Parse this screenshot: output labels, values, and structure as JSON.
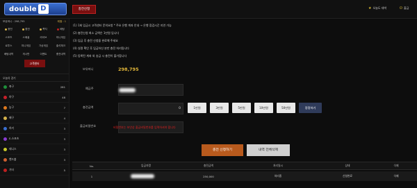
{
  "header": {
    "logo_text": "double",
    "logo_letter": "D",
    "active_tab": "충전신청",
    "right_items": [
      {
        "icon": "star-icon",
        "label": "오늘도 대박"
      },
      {
        "icon": "power-icon",
        "label": "출금"
      }
    ]
  },
  "sidebar": {
    "user_left": "보유머니 : 298,795",
    "user_right": "레벨 : 1",
    "grid": [
      [
        "충전",
        "환전",
        "쪽지",
        "베팅"
      ],
      [
        "스포츠",
        "스페셜",
        "라이브",
        "미니게임"
      ],
      [
        "로투스",
        "미니게임",
        "가상게임",
        "출석체크"
      ],
      [
        "베팅내역",
        "게시판",
        "이벤트",
        "충전내역"
      ]
    ],
    "active_item": "고객센터",
    "section_title": "오늘의 경기",
    "sports": [
      {
        "name": "축구",
        "count": "281",
        "color": "#1e8f3a"
      },
      {
        "name": "야구",
        "count": "48",
        "color": "#c8202a"
      },
      {
        "name": "농구",
        "count": "7",
        "color": "#e07a1f"
      },
      {
        "name": "배구",
        "count": "4",
        "color": "#d6b34b"
      },
      {
        "name": "하키",
        "count": "3",
        "color": "#3a6fd1"
      },
      {
        "name": "E-스포츠",
        "count": "3",
        "color": "#8a3ad1"
      },
      {
        "name": "테니스",
        "count": "3",
        "color": "#c8c82a"
      },
      {
        "name": "핸드볼",
        "count": "3",
        "color": "#d06030"
      },
      {
        "name": "기타",
        "count": "5",
        "color": "#c02020"
      }
    ]
  },
  "notices": [
    "(1) 1회 입금시 고객센터 문의요청 * 주요 은행 계좌 안내 → 은행 점검시간 지연 가능",
    "(2) 충전신청 최소 금액은 1만원 입니다",
    "(3) 입금 후 충전 신청을 완료해 주세요",
    "(4) 실명 확인 후 입금하신 분만 충전 처리됩니다",
    "(5) 동록된 계좌 외 송금 시 충전이 불가합니다"
  ],
  "form": {
    "balance_label": "보유머니",
    "balance_value": "298,795",
    "depositor_label": "예금주",
    "amount_label": "충전금액",
    "amount_value": "0",
    "amount_buttons": [
      "1만원",
      "3만원",
      "5만원",
      "10만원",
      "50만원"
    ],
    "reset_label": "정정하기",
    "password_label": "출금비밀번호",
    "password_warning": "비밀번호는 보안상 출금비밀번호를 입력하셔야 합니다"
  },
  "actions": {
    "submit": "충전 신청하기",
    "delete_all": "내역 전체삭제"
  },
  "table": {
    "headers": [
      "No.",
      "입금자명",
      "충전금액",
      "처리일시",
      "상태",
      "삭제"
    ],
    "rows": [
      [
        "1",
        "",
        "250,000",
        "처리중",
        "신청완료",
        "삭제"
      ]
    ]
  },
  "colors": {
    "accent_red": "#7a0f0f",
    "gold": "#e4b83a",
    "submit": "#b85a1d"
  }
}
